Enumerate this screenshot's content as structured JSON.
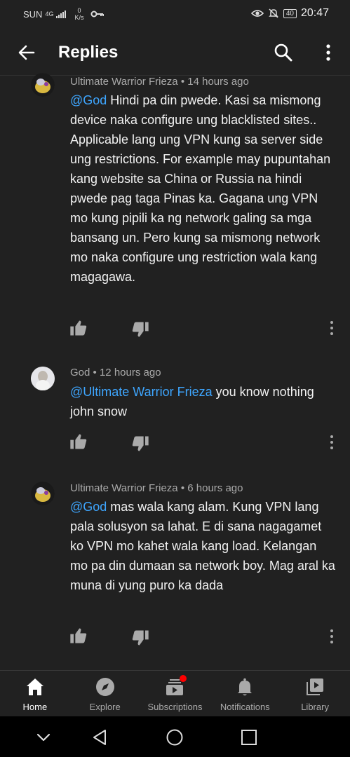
{
  "status_bar": {
    "carrier": "SUN",
    "network": "4G",
    "data_rate": "0",
    "data_unit": "K/s",
    "battery": "40",
    "time": "20:47"
  },
  "header": {
    "title": "Replies"
  },
  "comments": [
    {
      "author": "Ultimate Warrior Frieza",
      "time": "14 hours ago",
      "mention": "@God",
      "text": " Hindi pa din pwede. Kasi sa mismong device naka configure ung blacklisted sites.. Applicable lang ung VPN kung sa server side ung restrictions. For example may pupuntahan kang website sa China or Russia na hindi pwede pag taga Pinas ka. Gagana ung VPN mo kung pipili ka ng network galing sa mga bansang un. Pero kung sa mismong network mo naka configure ung restriction wala kang magagawa."
    },
    {
      "author": "God",
      "time": "12 hours ago",
      "mention": "@Ultimate Warrior Frieza",
      "text": " you know nothing john snow"
    },
    {
      "author": "Ultimate Warrior Frieza",
      "time": "6 hours ago",
      "mention": "@God",
      "text": " mas wala kang alam. Kung VPN lang pala solusyon sa lahat. E di sana nagagamet ko VPN mo kahet wala kang load. Kelangan mo pa din dumaan sa network boy. Mag aral ka muna di yung puro ka dada"
    }
  ],
  "meta_separator": "•",
  "bottom_nav": [
    {
      "label": "Home",
      "icon": "home-icon",
      "active": true
    },
    {
      "label": "Explore",
      "icon": "compass-icon",
      "active": false
    },
    {
      "label": "Subscriptions",
      "icon": "subscriptions-icon",
      "active": false
    },
    {
      "label": "Notifications",
      "icon": "bell-icon",
      "active": false
    },
    {
      "label": "Library",
      "icon": "library-icon",
      "active": false
    }
  ],
  "colors": {
    "background": "#212121",
    "mention": "#3ea6ff",
    "badge": "#ff0000"
  }
}
